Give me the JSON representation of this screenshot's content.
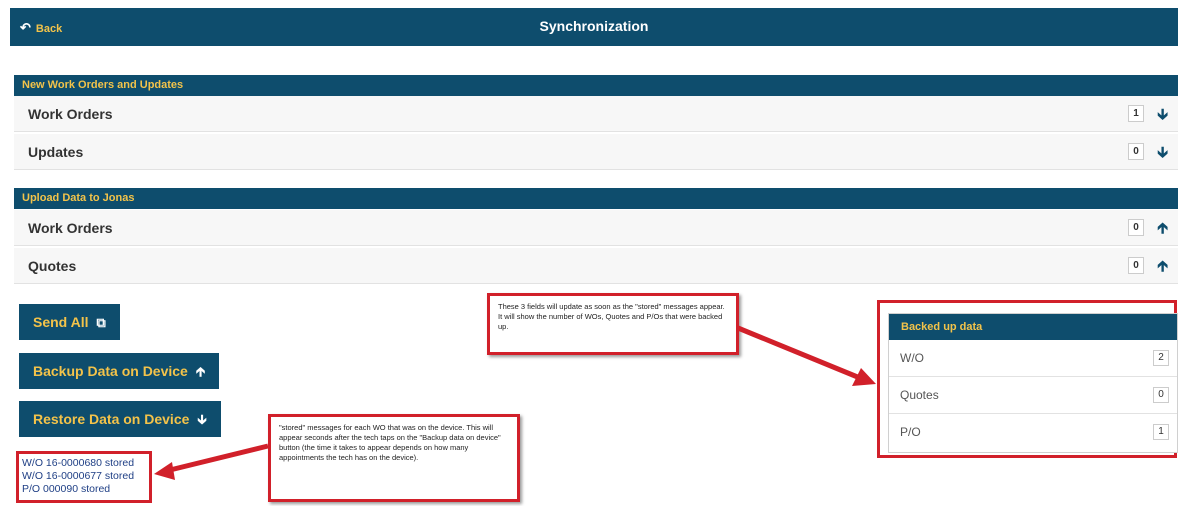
{
  "header": {
    "back_label": "Back",
    "title": "Synchronization"
  },
  "new_work_orders": {
    "heading": "New Work Orders and Updates",
    "rows": [
      {
        "label": "Work Orders",
        "count": "1",
        "icon": "arrow-down-icon"
      },
      {
        "label": "Updates",
        "count": "0",
        "icon": "arrow-down-icon"
      }
    ]
  },
  "upload": {
    "heading": "Upload Data to Jonas",
    "rows": [
      {
        "label": "Work Orders",
        "count": "0",
        "icon": "arrow-up-icon"
      },
      {
        "label": "Quotes",
        "count": "0",
        "icon": "arrow-up-icon"
      }
    ]
  },
  "actions": {
    "send_all": "Send All",
    "backup": "Backup Data on Device",
    "restore": "Restore Data on Device"
  },
  "stored_messages": [
    "W/O 16-0000680 stored",
    "W/O 16-0000677 stored",
    "P/O 000090 stored"
  ],
  "backed_up": {
    "heading": "Backed up data",
    "rows": [
      {
        "label": "W/O",
        "count": "2"
      },
      {
        "label": "Quotes",
        "count": "0"
      },
      {
        "label": "P/O",
        "count": "1"
      }
    ]
  },
  "annotations": {
    "fields_note": "These 3 fields will update as soon as the \"stored\" messages appear. It will show the number of WOs, Quotes and P/Os that were backed up.",
    "stored_note": "\"stored\" messages for each WO that was on the device. This will appear seconds after the tech taps on the \"Backup data on device\" button (the time it takes to appear depends on how many appointments the tech has on the device)."
  },
  "colors": {
    "header_bg": "#0e4d6d",
    "accent": "#f3c34a",
    "annotation": "#d1202a"
  }
}
